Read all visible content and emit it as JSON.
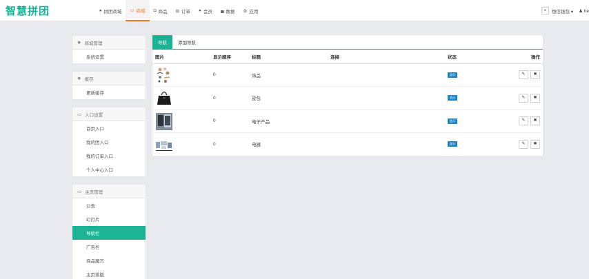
{
  "brand": {
    "logo": "智慧拼团"
  },
  "topnav": [
    {
      "icon": "home-icon",
      "glyph": "♠",
      "label": "拼团商城",
      "active": false
    },
    {
      "icon": "monitor-icon",
      "glyph": "▭",
      "label": "商城",
      "active": true
    },
    {
      "icon": "camera-icon",
      "glyph": "◘",
      "label": "商品",
      "active": false
    },
    {
      "icon": "cart-icon",
      "glyph": "⊞",
      "label": "订单",
      "active": false
    },
    {
      "icon": "user-icon",
      "glyph": "●",
      "label": "会员",
      "active": false
    },
    {
      "icon": "chart-icon",
      "glyph": "▄",
      "label": "数据",
      "active": false
    },
    {
      "icon": "cogs-icon",
      "glyph": "⚙",
      "label": "应用",
      "active": false
    }
  ],
  "topright": {
    "close": "×",
    "account": "恒信钱包 ▾",
    "user": "♟ he"
  },
  "sidebar": [
    {
      "icon": "gear-icon",
      "glyph": "✹",
      "title": "商城管理",
      "items": [
        {
          "label": "系统设置",
          "active": false
        }
      ]
    },
    {
      "icon": "gear-icon",
      "glyph": "✹",
      "title": "缓存",
      "items": [
        {
          "label": "更新缓存",
          "active": false
        }
      ]
    },
    {
      "icon": "window-icon",
      "glyph": "▭",
      "title": "入口设置",
      "items": [
        {
          "label": "首页入口",
          "active": false
        },
        {
          "label": "我的团入口",
          "active": false
        },
        {
          "label": "我的订单入口",
          "active": false
        },
        {
          "label": "个人中心入口",
          "active": false
        }
      ]
    },
    {
      "icon": "window-icon",
      "glyph": "▭",
      "title": "主页管理",
      "items": [
        {
          "label": "公告",
          "active": false
        },
        {
          "label": "幻灯片",
          "active": false
        },
        {
          "label": "导航栏",
          "active": true
        },
        {
          "label": "广告栏",
          "active": false
        },
        {
          "label": "商品魔方",
          "active": false
        },
        {
          "label": "主页排版",
          "active": false
        }
      ]
    }
  ],
  "tabs": [
    {
      "label": "导航",
      "active": true
    },
    {
      "label": "添加导航",
      "active": false
    }
  ],
  "table": {
    "headers": {
      "image": "图片",
      "order": "显示顺序",
      "title": "标题",
      "link": "连接",
      "status": "状态",
      "ops": "操作"
    },
    "rows": [
      {
        "thumb": "jewelry",
        "order": "0",
        "title": "饰品",
        "link": "",
        "status": "显示"
      },
      {
        "thumb": "bag",
        "order": "0",
        "title": "皮包",
        "link": "",
        "status": "显示"
      },
      {
        "thumb": "phone",
        "order": "0",
        "title": "电子产品",
        "link": "",
        "status": "显示"
      },
      {
        "thumb": "appliance",
        "order": "0",
        "title": "电器",
        "link": "",
        "status": "显示"
      }
    ],
    "edit_glyph": "✎",
    "delete_glyph": "✖"
  }
}
